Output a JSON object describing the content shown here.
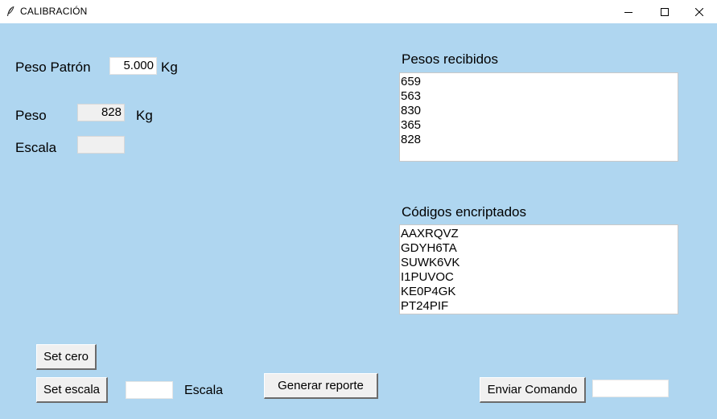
{
  "window": {
    "title": "CALIBRACIÓN",
    "icon": "feather-icon",
    "controls": [
      "minimize-icon",
      "maximize-icon",
      "close-icon"
    ]
  },
  "theme": {
    "background": "#afd6f0"
  },
  "form": {
    "peso_patron": {
      "label": "Peso Patrón",
      "value": "5.000",
      "unit": "Kg"
    },
    "peso": {
      "label": "Peso",
      "value": "828",
      "unit": "Kg"
    },
    "escala": {
      "label": "Escala",
      "value": ""
    }
  },
  "pesos_recibidos": {
    "label": "Pesos recibidos",
    "items": [
      "659",
      "563",
      "830",
      "365",
      "828"
    ]
  },
  "codigos_encriptados": {
    "label": "Códigos encriptados",
    "items": [
      "AAXRQVZ",
      "GDYH6TA",
      "SUWK6VK",
      "I1PUVOC",
      "KE0P4GK",
      "PT24PIF"
    ]
  },
  "controls": {
    "set_cero": "Set cero",
    "set_escala": "Set escala",
    "escala_input_value": "",
    "escala_label": "Escala",
    "generar_reporte": "Generar reporte",
    "enviar_comando": "Enviar Comando",
    "comando_input_value": ""
  }
}
